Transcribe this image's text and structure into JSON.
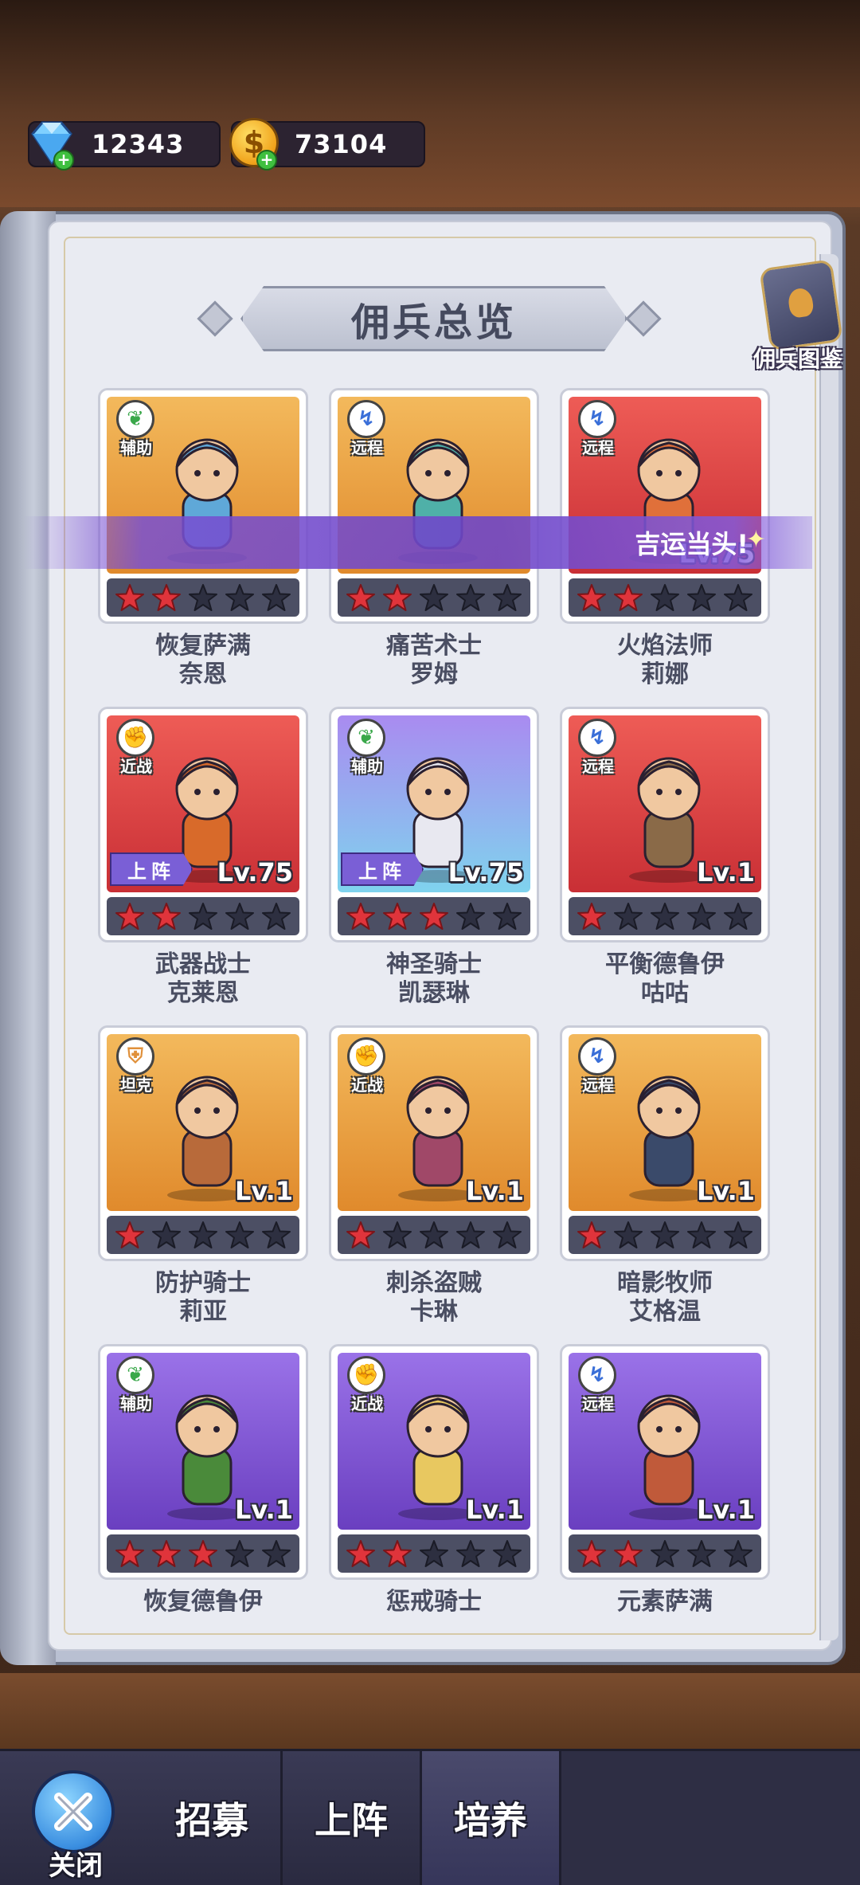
{
  "currency": {
    "gems": "12343",
    "gold": "73104",
    "gold_symbol": "$"
  },
  "page": {
    "title": "佣兵总览",
    "codex_label": "佣兵图鉴"
  },
  "luck_banner": "吉运当头!",
  "deployed_label": "上阵",
  "mercenaries": [
    {
      "role": "辅助",
      "role_type": "support",
      "level": "",
      "deployed": false,
      "stars": 2,
      "name1": "恢复萨满",
      "name2": "奈恩",
      "bg": "orange"
    },
    {
      "role": "远程",
      "role_type": "ranged",
      "level": "",
      "deployed": false,
      "stars": 2,
      "name1": "痛苦术士",
      "name2": "罗姆",
      "bg": "orange"
    },
    {
      "role": "远程",
      "role_type": "ranged",
      "level": "Lv.75",
      "deployed": false,
      "stars": 2,
      "name1": "火焰法师",
      "name2": "莉娜",
      "bg": "red"
    },
    {
      "role": "近战",
      "role_type": "melee",
      "level": "Lv.75",
      "deployed": true,
      "stars": 2,
      "name1": "武器战士",
      "name2": "克莱恩",
      "bg": "red"
    },
    {
      "role": "辅助",
      "role_type": "support",
      "level": "Lv.75",
      "deployed": true,
      "stars": 3,
      "name1": "神圣骑士",
      "name2": "凯瑟琳",
      "bg": "holy"
    },
    {
      "role": "远程",
      "role_type": "ranged",
      "level": "Lv.1",
      "deployed": false,
      "stars": 1,
      "name1": "平衡德鲁伊",
      "name2": "咕咕",
      "bg": "red"
    },
    {
      "role": "坦克",
      "role_type": "tank",
      "level": "Lv.1",
      "deployed": false,
      "stars": 1,
      "name1": "防护骑士",
      "name2": "莉亚",
      "bg": "orange"
    },
    {
      "role": "近战",
      "role_type": "melee",
      "level": "Lv.1",
      "deployed": false,
      "stars": 1,
      "name1": "刺杀盗贼",
      "name2": "卡琳",
      "bg": "orange"
    },
    {
      "role": "远程",
      "role_type": "ranged",
      "level": "Lv.1",
      "deployed": false,
      "stars": 1,
      "name1": "暗影牧师",
      "name2": "艾格温",
      "bg": "orange"
    },
    {
      "role": "辅助",
      "role_type": "support",
      "level": "Lv.1",
      "deployed": false,
      "stars": 3,
      "name1": "恢复德鲁伊",
      "name2": "",
      "bg": "purple"
    },
    {
      "role": "近战",
      "role_type": "melee",
      "level": "Lv.1",
      "deployed": false,
      "stars": 2,
      "name1": "惩戒骑士",
      "name2": "",
      "bg": "purple"
    },
    {
      "role": "远程",
      "role_type": "ranged",
      "level": "Lv.1",
      "deployed": false,
      "stars": 2,
      "name1": "元素萨满",
      "name2": "",
      "bg": "purple"
    }
  ],
  "nav": {
    "close": "关闭",
    "recruit": "招募",
    "deploy": "上阵",
    "train": "培养"
  },
  "colors": {
    "star_filled": "#e0343b",
    "star_empty": "#2d2f40",
    "accent_purple": "#7a5fd6"
  }
}
